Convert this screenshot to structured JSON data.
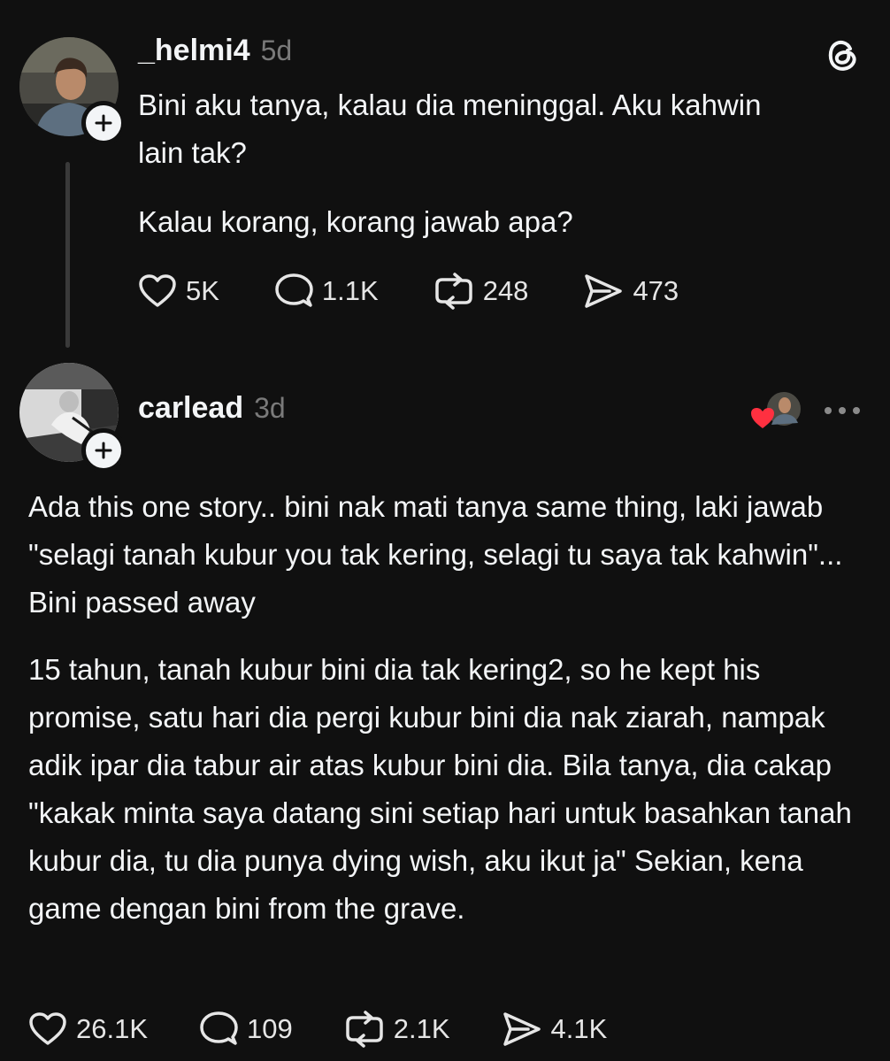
{
  "post": {
    "username": "_helmi4",
    "time": "5d",
    "paragraphs": [
      "Bini aku tanya, kalau dia meninggal. Aku kahwin lain tak?",
      "Kalau korang, korang jawab apa?"
    ],
    "stats": {
      "likes": "5K",
      "replies": "1.1K",
      "reposts": "248",
      "shares": "473"
    }
  },
  "reply": {
    "username": "carlead",
    "time": "3d",
    "paragraphs": [
      "Ada this one story.. bini nak mati tanya same thing, laki jawab \"selagi tanah kubur you tak kering, selagi tu saya tak kahwin\"... Bini passed away",
      "15 tahun, tanah kubur bini dia tak kering2, so he kept his promise, satu hari dia pergi kubur bini dia nak ziarah, nampak adik ipar dia tabur air atas kubur bini dia. Bila tanya, dia cakap \"kakak minta saya datang sini setiap hari untuk basahkan tanah kubur dia, tu dia punya dying wish, aku ikut ja\" Sekian, kena game dengan bini from the grave."
    ],
    "stats": {
      "likes": "26.1K",
      "replies": "109",
      "reposts": "2.1K",
      "shares": "4.1K"
    }
  },
  "icons": {
    "like": "heart-icon",
    "reply": "comment-bubble-icon",
    "repost": "repost-icon",
    "share": "send-icon",
    "brand": "threads-logo-icon",
    "more": "more-horizontal-icon",
    "follow": "plus-icon"
  },
  "colors": {
    "background": "#101010",
    "text": "#f3f5f7",
    "muted": "#7a7a7a",
    "heart": "#ff3040"
  }
}
